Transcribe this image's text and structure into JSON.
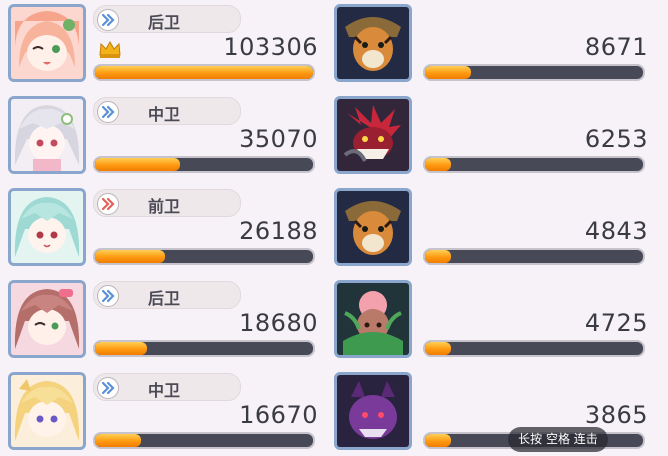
{
  "ally_rows": [
    {
      "position": "后卫",
      "damage": "103306",
      "bar_fraction": 1.0,
      "mvp": true,
      "chevron": "blue"
    },
    {
      "position": "中卫",
      "damage": "35070",
      "bar_fraction": 0.39,
      "mvp": false,
      "chevron": "blue"
    },
    {
      "position": "前卫",
      "damage": "26188",
      "bar_fraction": 0.32,
      "mvp": false,
      "chevron": "red"
    },
    {
      "position": "后卫",
      "damage": "18680",
      "bar_fraction": 0.24,
      "mvp": false,
      "chevron": "blue"
    },
    {
      "position": "中卫",
      "damage": "16670",
      "bar_fraction": 0.21,
      "mvp": false,
      "chevron": "blue"
    }
  ],
  "enemy_rows": [
    {
      "damage": "8671",
      "bar_fraction": 0.21
    },
    {
      "damage": "6253",
      "bar_fraction": 0.12
    },
    {
      "damage": "4843",
      "bar_fraction": 0.12
    },
    {
      "damage": "4725",
      "bar_fraction": 0.12
    },
    {
      "damage": "3865",
      "bar_fraction": 0.12
    }
  ],
  "hint_text": "长按 空格 连击",
  "colors": {
    "bar_fill": "#ff9a12",
    "bar_track": "#474a56",
    "avatar_border": "#8aa6cc",
    "chevron_blue": "#5b8fd8",
    "chevron_red": "#e0605a"
  }
}
